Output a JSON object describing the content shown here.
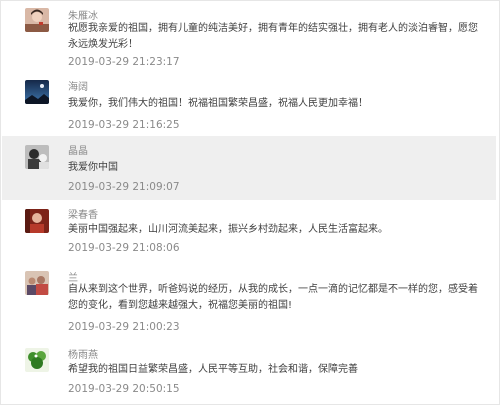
{
  "comments": [
    {
      "name": "朱雁冰",
      "text": "祝愿我亲爱的祖国，拥有儿童的纯洁美好，拥有青年的结实强壮，拥有老人的淡泊睿智，愿您永远焕发光彩！",
      "time": "2019-03-29 21:23:17",
      "avatar": "portrait-avatar-icon"
    },
    {
      "name": "海阔",
      "text": "我爱你，我们伟大的祖国！祝福祖国繁荣昌盛，祝福人民更加幸福！",
      "time": "2019-03-29 21:16:25",
      "avatar": "night-sky-avatar-icon"
    },
    {
      "name": "晶晶",
      "text": "我爱你中国",
      "time": "2019-03-29 21:09:07",
      "avatar": "black-white-photo-avatar-icon"
    },
    {
      "name": "梁春香",
      "text": "美丽中国强起来，山川河流美起来，振兴乡村劲起来，人民生活富起来。",
      "time": "2019-03-29 21:08:06",
      "avatar": "red-photo-avatar-icon"
    },
    {
      "name": "兰",
      "text": "自从来到这个世界，听爸妈说的经历，从我的成长，一点一滴的记忆都是不一样的您，感受着您的变化，看到您越来越强大，祝福您美丽的祖国!",
      "time": "2019-03-29 21:00:23",
      "avatar": "family-photo-avatar-icon"
    },
    {
      "name": "杨雨燕",
      "text": "希望我的祖国日益繁荣昌盛，人民平等互助，社会和谐，保障完善",
      "time": "2019-03-29 20:50:15",
      "avatar": "green-plant-avatar-icon"
    }
  ]
}
